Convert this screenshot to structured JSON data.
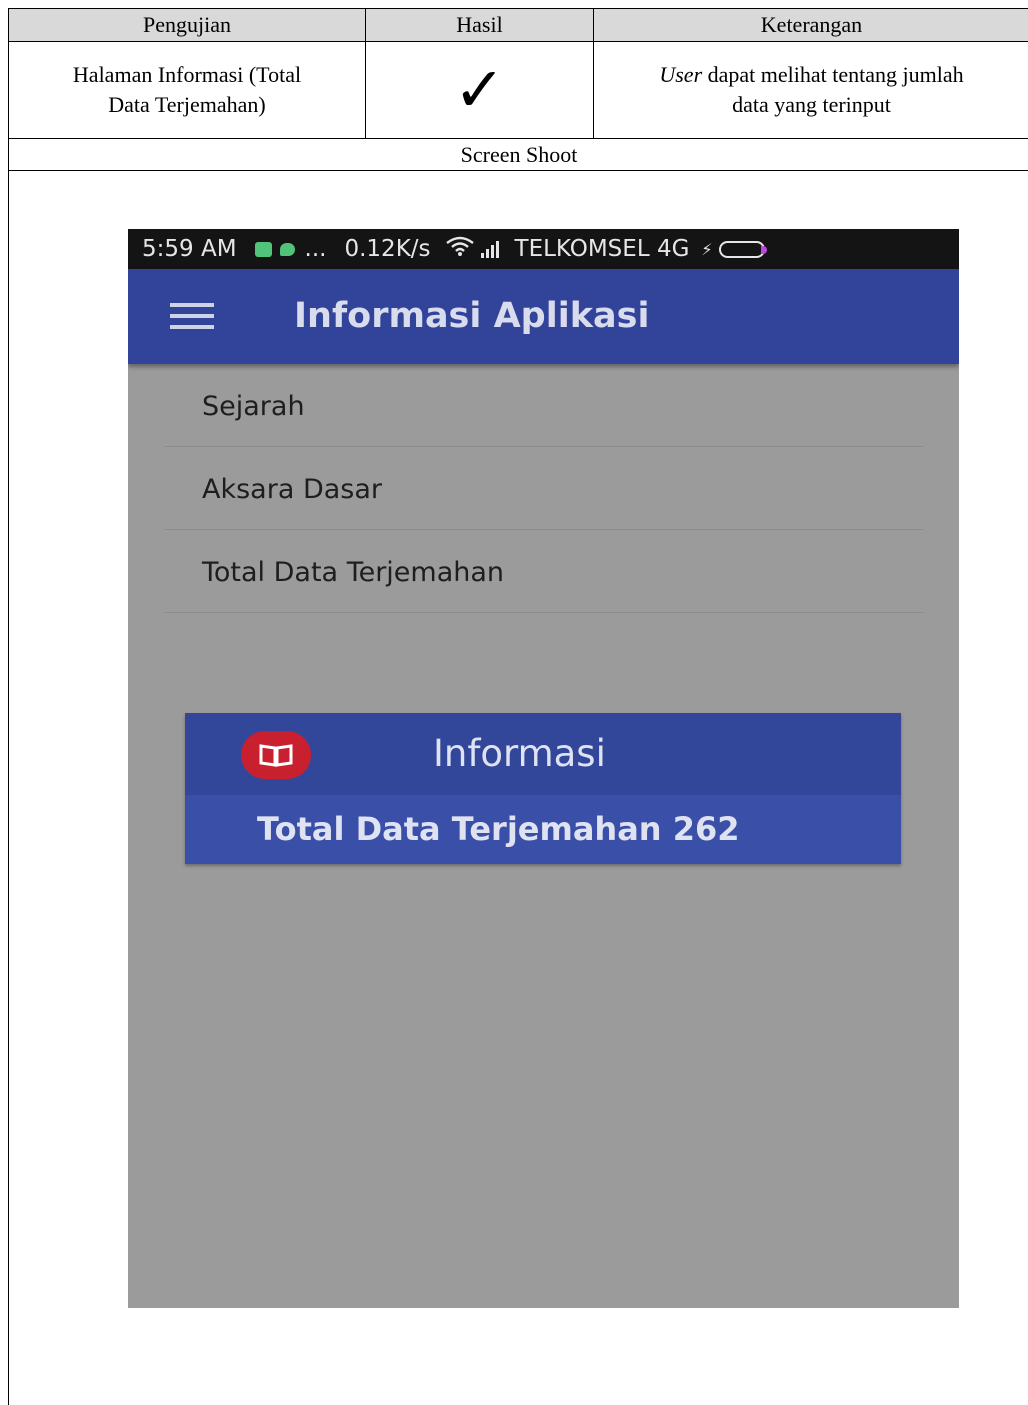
{
  "table": {
    "headers": [
      "Pengujian",
      "Hasil",
      "Keterangan"
    ],
    "row": {
      "pengujian": [
        "Halaman Informasi (Total",
        "Data Terjemahan)"
      ],
      "hasil_symbol": "✓",
      "keterangan_italic": "User",
      "keterangan_line1_rest": " dapat melihat tentang jumlah",
      "keterangan_line2": "data yang terinput"
    },
    "screenshot_label": "Screen Shoot"
  },
  "phone": {
    "status_bar": {
      "time": "5:59 AM",
      "dots": "...",
      "speed": "0.12K/s",
      "carrier": "TELKOMSEL 4G",
      "charging_symbol": "⚡"
    },
    "app_bar": {
      "title": "Informasi Aplikasi",
      "menu_icon": "hamburger-menu-icon"
    },
    "menu_items": [
      "Sejarah",
      "Aksara Dasar",
      "Total Data Terjemahan"
    ],
    "info_card": {
      "icon": "book-icon",
      "title": "Informasi",
      "body": "Total Data Terjemahan 262"
    },
    "colors": {
      "app_bar": "#31449a",
      "background": "#9b9b9b",
      "card": "#3a4fa8",
      "icon_badge": "#c8202e"
    }
  }
}
